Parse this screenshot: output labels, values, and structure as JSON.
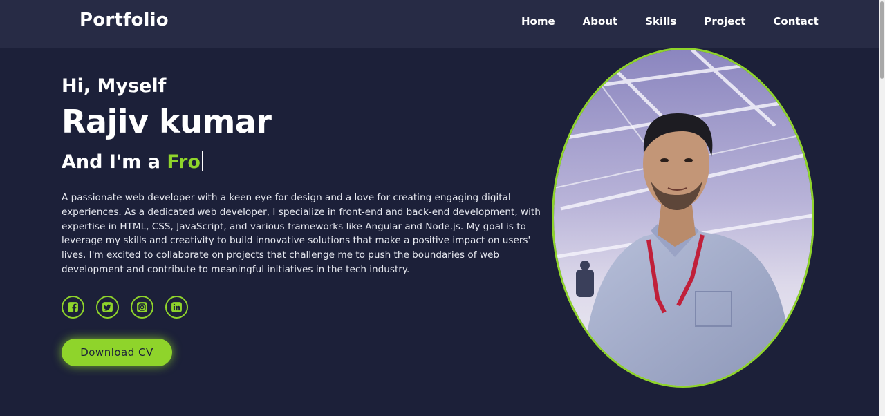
{
  "navbar": {
    "logo": "Portfolio",
    "links": [
      {
        "label": "Home"
      },
      {
        "label": "About"
      },
      {
        "label": "Skills"
      },
      {
        "label": "Project"
      },
      {
        "label": "Contact"
      }
    ]
  },
  "hero": {
    "greeting": "Hi, Myself",
    "name": "Rajiv kumar",
    "role_prefix": "And I'm a ",
    "role_typed": "Fro",
    "bio": "A passionate web developer with a keen eye for design and a love for creating engaging digital experiences. As a dedicated web developer, I specialize in front-end and back-end development, with expertise in HTML, CSS, JavaScript, and various frameworks like Angular and Node.js. My goal is to leverage my skills and creativity to build innovative solutions that make a positive impact on users' lives. I'm excited to collaborate on projects that challenge me to push the boundaries of web development and contribute to meaningful initiatives in the tech industry.",
    "socials": [
      {
        "icon": "facebook-icon"
      },
      {
        "icon": "twitter-icon"
      },
      {
        "icon": "instagram-icon"
      },
      {
        "icon": "linkedin-icon"
      }
    ],
    "download_label": "Download CV"
  },
  "colors": {
    "accent": "#8fd42b",
    "background": "#1c2039",
    "navbar": "#272b45",
    "text": "#ffffff"
  }
}
